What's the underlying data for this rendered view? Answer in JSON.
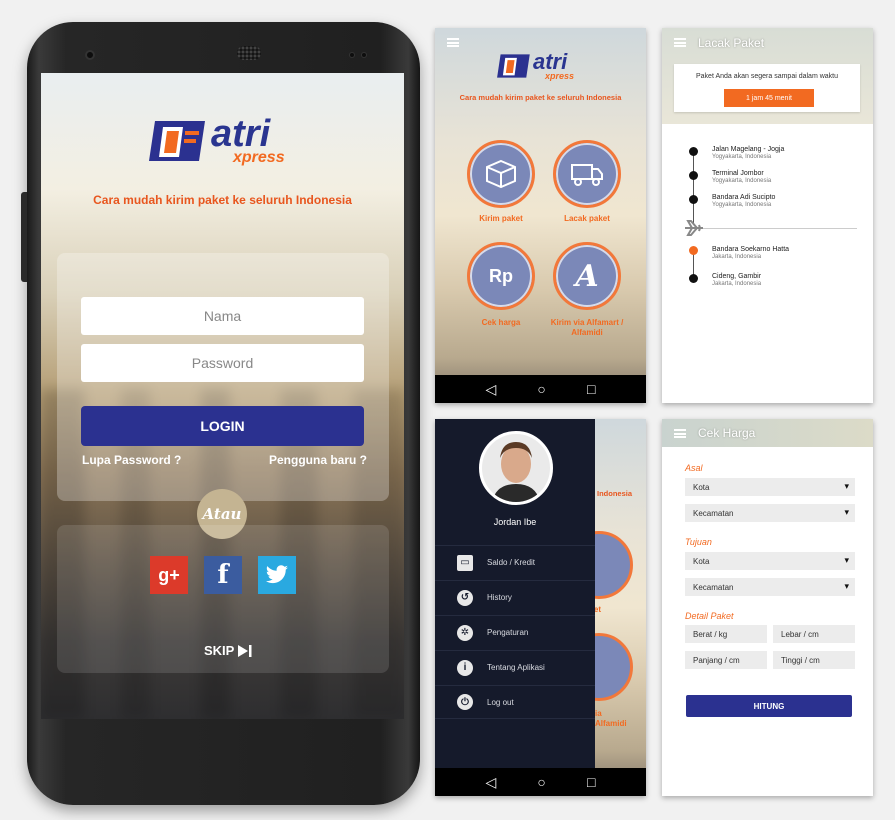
{
  "brand": {
    "name_main": "atri",
    "name_sub": "xpress",
    "tagline": "Cara mudah kirim paket ke seluruh Indonesia",
    "colors": {
      "primary": "#2b3190",
      "accent": "#f26a21"
    }
  },
  "login": {
    "name_placeholder": "Nama",
    "password_placeholder": "Password",
    "login_label": "LOGIN",
    "forgot_label": "Lupa Password ?",
    "new_user_label": "Pengguna baru ?",
    "or_label": "Atau",
    "google_label": "g+",
    "facebook_label": "f",
    "skip_label": "SKIP"
  },
  "home": {
    "tagline": "Cara mudah kirim paket ke seluruh Indonesia",
    "tiles": [
      {
        "label": "Kirim paket",
        "icon": "box-icon"
      },
      {
        "label": "Lacak paket",
        "icon": "truck-icon"
      },
      {
        "label": "Cek harga",
        "icon": "rp-icon",
        "glyph": "Rp"
      },
      {
        "label": "Kirim via Alfamart / Alfamidi",
        "icon": "alfamart-icon",
        "glyph": "A"
      }
    ]
  },
  "track": {
    "title": "Lacak Paket",
    "notice": "Paket Anda akan segera sampai dalam waktu",
    "eta": "1 jam 45 menit",
    "stops": [
      {
        "name": "Jalan Magelang - Jogja",
        "city": "Yogyakarta, Indonesia"
      },
      {
        "name": "Terminal Jombor",
        "city": "Yogyakarta, Indonesia"
      },
      {
        "name": "Bandara Adi Sucipto",
        "city": "Yogyakarta, Indonesia"
      },
      {
        "name": "Bandara Soekarno Hatta",
        "city": "Jakarta, Indonesia"
      },
      {
        "name": "Cideng, Gambir",
        "city": "Jakarta, Indonesia"
      }
    ]
  },
  "drawer": {
    "user_name": "Jordan  Ibe",
    "items": [
      {
        "label": "Saldo / Kredit",
        "icon": "card-icon"
      },
      {
        "label": "History",
        "icon": "history-icon"
      },
      {
        "label": "Pengaturan",
        "icon": "gear-icon"
      },
      {
        "label": "Tentang Aplikasi",
        "icon": "info-icon"
      },
      {
        "label": "Log out",
        "icon": "power-icon"
      }
    ],
    "peek_tagline": "Indonesia",
    "peek_label1": "aket",
    "peek_label2": "ia",
    "peek_label3": "Alfamidi"
  },
  "price": {
    "title": "Cek Harga",
    "asal_label": "Asal",
    "tujuan_label": "Tujuan",
    "detail_label": "Detail Paket",
    "kota": "Kota",
    "kecamatan": "Kecamatan",
    "berat": "Berat / kg",
    "lebar": "Lebar / cm",
    "panjang": "Panjang / cm",
    "tinggi": "Tinggi / cm",
    "button": "HITUNG"
  }
}
